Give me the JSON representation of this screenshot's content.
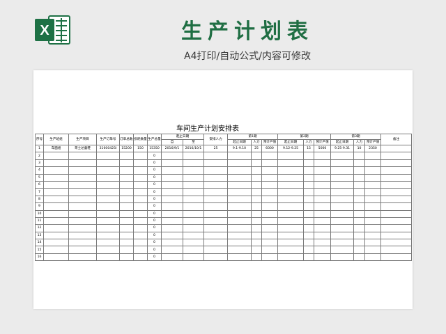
{
  "header": {
    "logo_letter": "X",
    "title": "生产计划表",
    "subtitle": "A4打印/自动公式/内容可修改"
  },
  "colors": {
    "title_green": "#1f6e43",
    "excel_green": "#1e7145"
  },
  "sheet": {
    "title": "车间生产计划安排表",
    "headers": {
      "seq": "序号",
      "team": "生产班组",
      "project": "生产项目",
      "order_no": "生产订单号",
      "order_qty": "订单总数量",
      "loss_qty": "损耗数量",
      "total_qty": "生产总量",
      "start_end": "起止日期",
      "from": "自",
      "to": "至",
      "staff": "安排人力",
      "phase1": "第1期",
      "phase2": "第2期",
      "phase3": "第3期",
      "sub_dates": "起止日期",
      "sub_staff": "人力",
      "sub_output": "预计产值",
      "remarks": "备注"
    },
    "rows": [
      {
        "seq": "1",
        "team": "车面组",
        "project": "哥士达童鞋",
        "order_no": "31600425I",
        "order_qty": "15200",
        "loss_qty": "150",
        "total_qty": "15350",
        "from": "2016/9/1",
        "to": "2016/10/1",
        "staff": "25",
        "p1_dates": "9.1-9.10",
        "p1_staff": "25",
        "p1_output": "6000",
        "p2_dates": "9.12-9.25",
        "p2_staff": "15",
        "p2_output": "5000",
        "p3_dates": "9.25-9.31",
        "p3_staff": "10",
        "p3_output": "2350",
        "remarks": ""
      },
      {
        "seq": "2",
        "total_qty": "0"
      },
      {
        "seq": "3",
        "total_qty": "0"
      },
      {
        "seq": "4",
        "total_qty": "0"
      },
      {
        "seq": "5",
        "total_qty": "0"
      },
      {
        "seq": "6",
        "total_qty": "0"
      },
      {
        "seq": "7",
        "total_qty": "0"
      },
      {
        "seq": "8",
        "total_qty": "0"
      },
      {
        "seq": "9",
        "total_qty": "0"
      },
      {
        "seq": "10",
        "total_qty": "0"
      },
      {
        "seq": "11",
        "total_qty": "0"
      },
      {
        "seq": "12",
        "total_qty": "0"
      },
      {
        "seq": "13",
        "total_qty": "0"
      },
      {
        "seq": "14",
        "total_qty": "0"
      },
      {
        "seq": "15",
        "total_qty": "0"
      },
      {
        "seq": "16",
        "total_qty": "0"
      }
    ]
  }
}
